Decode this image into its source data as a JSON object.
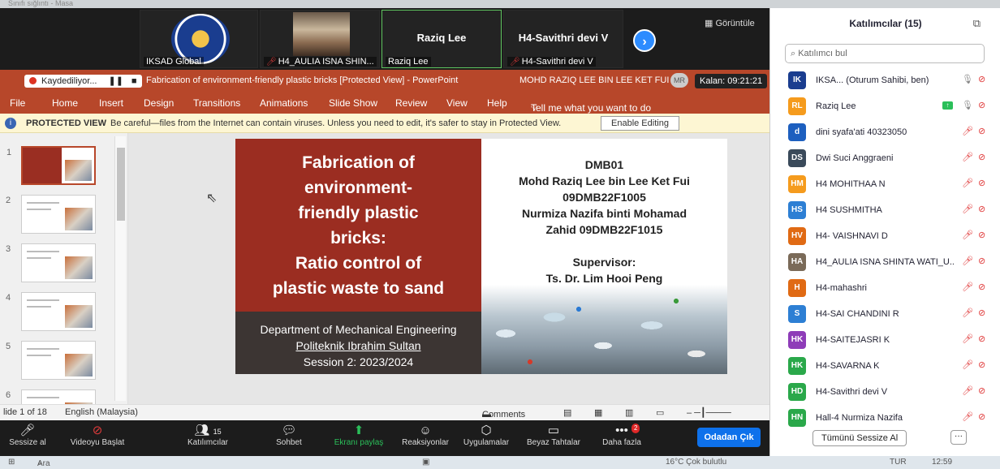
{
  "topstrip": {
    "text": "Sınıfı sığlıntı - Masa"
  },
  "video": {
    "tiles": [
      {
        "name": "IKSAD Global",
        "muted": false
      },
      {
        "name": "H4_AULIA ISNA SHIN...",
        "muted": true
      },
      {
        "big": "Raziq Lee",
        "name": "Raziq Lee",
        "muted": false
      },
      {
        "big": "H4-Savithri devi V",
        "name": "H4-Savithri devi V",
        "muted": true
      }
    ],
    "view_label": "Görüntüle"
  },
  "ppt": {
    "recording": "Kaydediliyor...",
    "title": "Fabrication of environment-friendly plastic bricks [Protected View] - PowerPoint",
    "user": "MOHD RAZIQ LEE BIN LEE KET FUI",
    "user_initials": "MR",
    "timer": "Kalan: 09:21:21",
    "menu": [
      "File",
      "Home",
      "Insert",
      "Design",
      "Transitions",
      "Animations",
      "Slide Show",
      "Review",
      "View",
      "Help",
      "Tell me what you want to do"
    ],
    "protected": {
      "label": "PROTECTED VIEW",
      "message": "Be careful—files from the Internet can contain viruses. Unless you need to edit, it's safer to stay in Protected View.",
      "button": "Enable Editing"
    },
    "thumb_numbers": [
      "1",
      "2",
      "3",
      "4",
      "5",
      "6"
    ],
    "slide": {
      "title_lines": [
        "Fabrication of",
        "environment-",
        "friendly plastic",
        "bricks:",
        "Ratio control of",
        "plastic waste to sand"
      ],
      "dept_lines": [
        "Department of Mechanical Engineering",
        "Politeknik Ibrahim Sultan",
        "Session 2: 2023/2024"
      ],
      "right_lines": [
        "DMB01",
        "Mohd Raziq Lee bin Lee Ket Fui",
        "09DMB22F1005",
        "Nurmiza Nazifa binti Mohamad",
        "Zahid 09DMB22F1015"
      ],
      "supervisor_lines": [
        "Supervisor:",
        "Ts. Dr. Lim Hooi Peng"
      ]
    },
    "status": {
      "slide": "lide 1 of 18",
      "lang": "English (Malaysia)",
      "comments": "Comments"
    }
  },
  "toolbar": {
    "items": [
      "Sessize al",
      "Videoyu Başlat",
      "Katılımcılar",
      "Sohbet",
      "Ekranı paylaş",
      "Reaksiyonlar",
      "Uygulamalar",
      "Beyaz Tahtalar",
      "Daha fazla"
    ],
    "participant_count": "15",
    "more_badge": "2",
    "leave": "Odadan Çık"
  },
  "taskbar": {
    "search": "Ara",
    "weather": "16°C Çok bulutlu",
    "lang": "TUR",
    "time": "12:59"
  },
  "panel": {
    "title": "Katılımcılar (15)",
    "search_placeholder": "Katılımcı bul",
    "participants": [
      {
        "initials": "IK",
        "name": "IKSA...   (Oturum Sahibi, ben)",
        "color": "#1a3d8f"
      },
      {
        "initials": "RL",
        "name": "Raziq Lee",
        "color": "#f59b1d"
      },
      {
        "initials": "d",
        "name": "dini syafa'ati 40323050",
        "color": "#1d5fbf"
      },
      {
        "initials": "DS",
        "name": "Dwi Suci Anggraeni",
        "color": "#3a4a5a"
      },
      {
        "initials": "HM",
        "name": "H4 MOHITHAA N",
        "color": "#f59b1d"
      },
      {
        "initials": "HS",
        "name": "H4 SUSHMITHA",
        "color": "#2d7fd4"
      },
      {
        "initials": "HV",
        "name": "H4- VAISHNAVI D",
        "color": "#e06a14"
      },
      {
        "initials": "HA",
        "name": "H4_AULIA ISNA SHINTA WATI_U...",
        "color": "#7a6a58"
      },
      {
        "initials": "H",
        "name": "H4-mahashri",
        "color": "#e06a14"
      },
      {
        "initials": "S",
        "name": "H4-SAI CHANDINI R",
        "color": "#2d7fd4"
      },
      {
        "initials": "HK",
        "name": "H4-SAITEJASRI K",
        "color": "#8e3cb8"
      },
      {
        "initials": "HK",
        "name": "H4-SAVARNA K",
        "color": "#2aa84a"
      },
      {
        "initials": "HD",
        "name": "H4-Savithri devi V",
        "color": "#2aa84a"
      },
      {
        "initials": "HN",
        "name": "Hall-4 Nurmiza Nazifa",
        "color": "#2aa84a"
      }
    ],
    "mute_all": "Tümünü Sessize Al",
    "more": "···"
  }
}
